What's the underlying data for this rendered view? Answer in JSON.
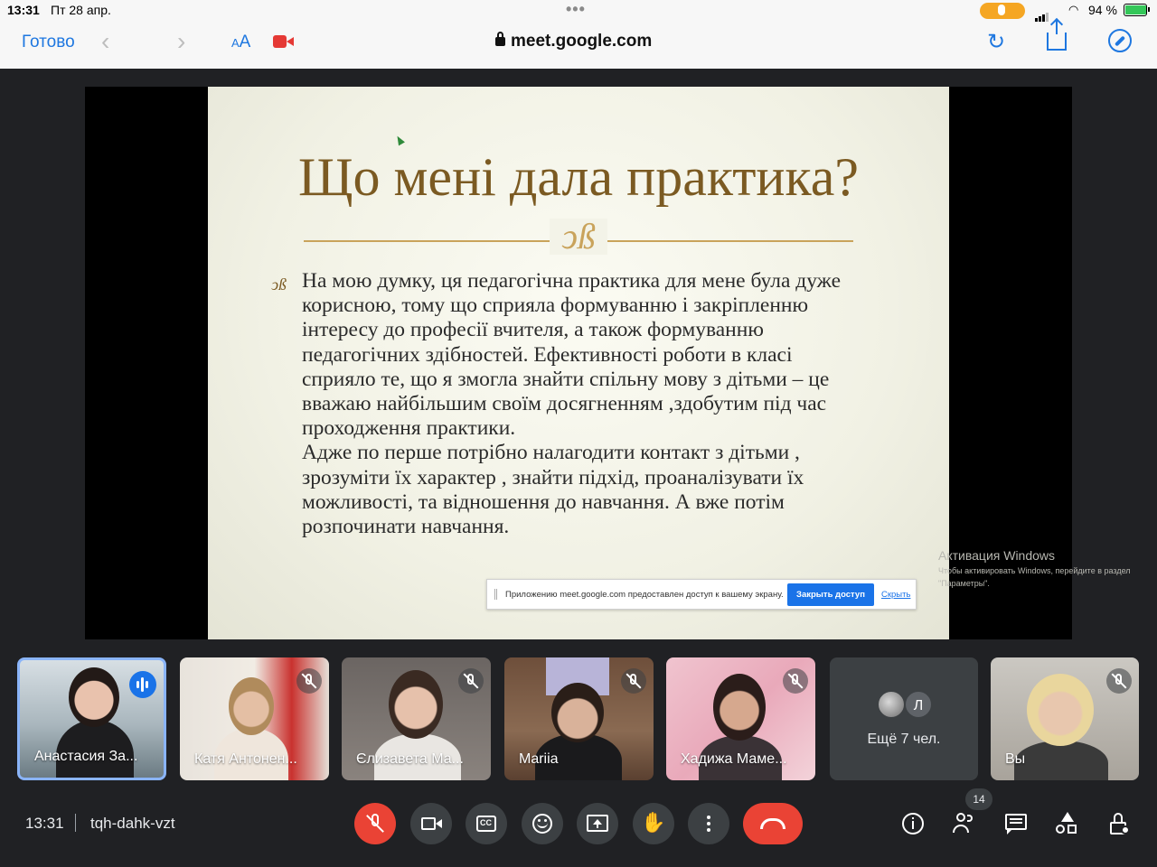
{
  "status_bar": {
    "time": "13:31",
    "date": "Пт 28 апр.",
    "battery": "94 %",
    "battery_level": 0.94,
    "colors": {
      "mic_indicator": "#f5a623",
      "battery": "#34c759"
    }
  },
  "browser": {
    "done_label": "Готово",
    "text_size_label": "AA",
    "url": "meet.google.com",
    "icons": [
      "back-icon",
      "forward-icon",
      "camera-icon",
      "lock-icon",
      "reload-icon",
      "share-icon",
      "compass-icon"
    ],
    "accent_color": "#1e77e0"
  },
  "slide": {
    "title": "Що мені дала практика?",
    "ornament": "ↄß",
    "bullet": "ↄß",
    "body": "На мою думку, ця педагогічна практика для мене була дуже\nкорисною, тому що сприяла формуванню і закріпленню\nінтересу до професії вчителя, а також формуванню\nпедагогічних здібностей. Ефективності роботи в класі\nсприяло те, що я змогла знайти спільну мову з дітьми – це\nвважаю найбільшим своїм досягненням ,здобутим під час\nпроходження практики.\nАдже  по перше потрібно налагодити контакт з дітьми ,\nзрозуміти їх характер , знайти підхід, проаналізувати їх\nможливості, та відношення до навчання. А вже потім\nрозпочинати навчання.",
    "colors": {
      "title": "#7b5a22",
      "divider": "#c9a35b"
    }
  },
  "windows_activation": {
    "heading": "Активация Windows",
    "line1": "Чтобы активировать Windows, перейдите в раздел",
    "line2": "\"Параметры\"."
  },
  "share_bar": {
    "message": "Приложению meet.google.com предоставлен доступ к вашему экрану.",
    "stop_button": "Закрыть доступ",
    "hide_link": "Скрыть"
  },
  "participants": [
    {
      "name": "Анастасия За...",
      "state": "speaking"
    },
    {
      "name": "Катя Антонен...",
      "state": "muted"
    },
    {
      "name": "Єлизавета Ма...",
      "state": "muted"
    },
    {
      "name": "Mariia",
      "state": "muted"
    },
    {
      "name": "Хадижа Маме...",
      "state": "muted"
    },
    {
      "name": "Вы",
      "state": "muted"
    }
  ],
  "more_tile": {
    "avatar_letter": "Л",
    "label": "Ещё 7 чел."
  },
  "meeting": {
    "time": "13:31",
    "code": "tqh-dahk-vzt",
    "participant_count": "14",
    "controls": [
      "mic-off-icon",
      "camera-icon",
      "captions-icon",
      "emoji-icon",
      "present-icon",
      "raise-hand-icon",
      "more-icon",
      "hang-up-icon"
    ],
    "side_controls": [
      "info-icon",
      "people-icon",
      "chat-icon",
      "activities-icon",
      "host-controls-icon"
    ],
    "colors": {
      "hang_up": "#ea4335",
      "speaking": "#1a73e8",
      "active_border": "#8ab4f8"
    }
  }
}
